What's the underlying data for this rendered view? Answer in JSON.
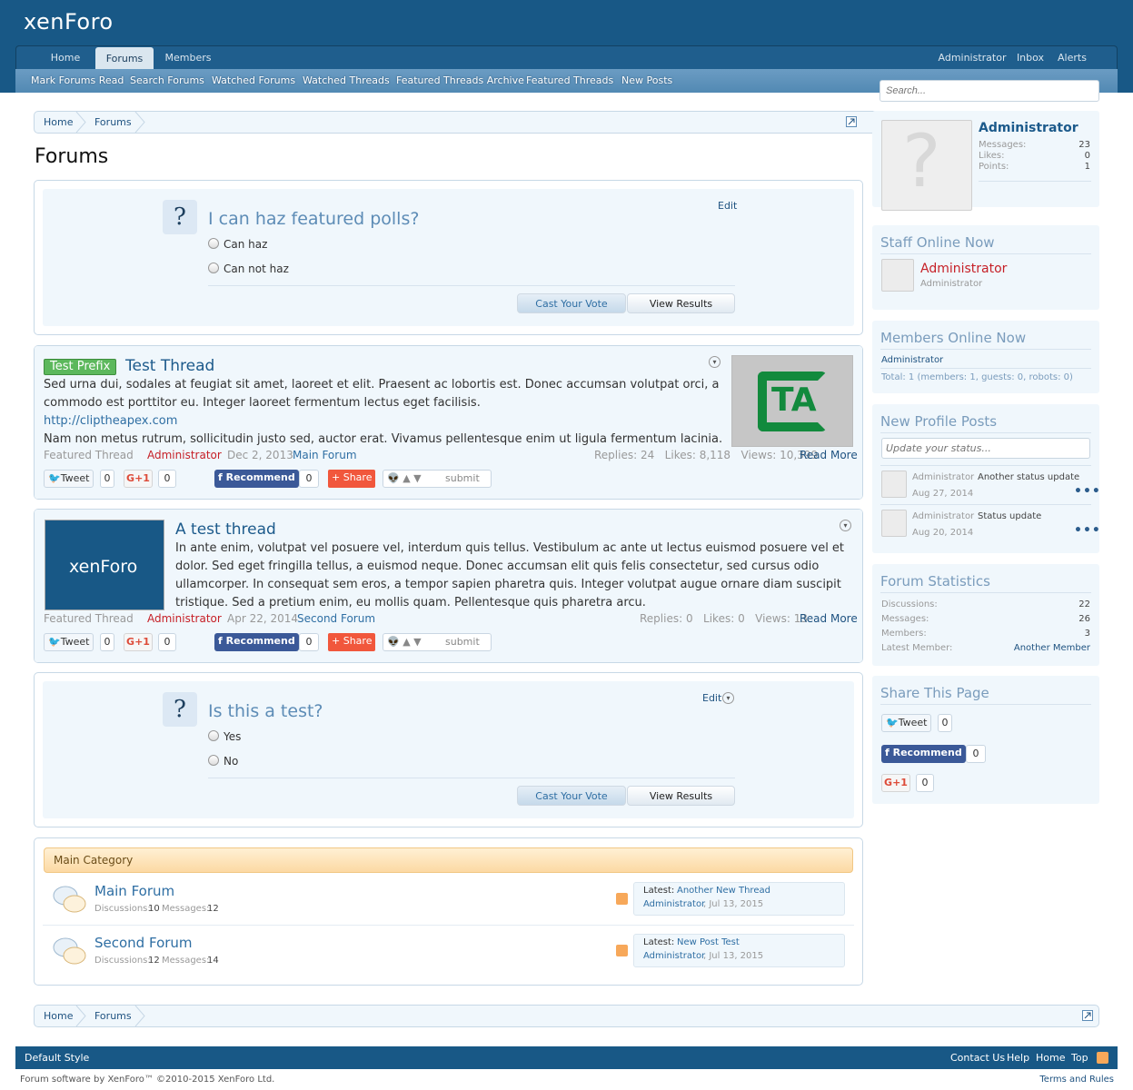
{
  "brand": {
    "logo": "xenForo",
    "accent": "#185886"
  },
  "nav": {
    "tabs": [
      {
        "label": "Home"
      },
      {
        "label": "Forums"
      },
      {
        "label": "Members"
      }
    ],
    "right": [
      {
        "label": "Administrator"
      },
      {
        "label": "Inbox"
      },
      {
        "label": "Alerts"
      }
    ],
    "subtabs": [
      {
        "label": "Mark Forums Read"
      },
      {
        "label": "Search Forums"
      },
      {
        "label": "Watched Forums"
      },
      {
        "label": "Watched Threads"
      },
      {
        "label": "Featured Threads Archive"
      },
      {
        "label": "Featured Threads"
      },
      {
        "label": "New Posts"
      }
    ]
  },
  "search": {
    "placeholder": "Search..."
  },
  "breadcrumb": [
    {
      "label": "Home"
    },
    {
      "label": "Forums"
    }
  ],
  "page_title": "Forums",
  "poll1": {
    "question": "I can haz featured polls?",
    "edit": "Edit",
    "options": [
      "Can haz",
      "Can not haz"
    ],
    "vote": "Cast Your Vote",
    "results": "View Results"
  },
  "thread1": {
    "prefix": "Test Prefix",
    "title": "Test Thread",
    "text1": "Sed urna dui, sodales at feugiat sit amet, laoreet et elit. Praesent ac lobortis est. Donec accumsan volutpat orci, a",
    "text2": "commodo est porttitor eu. Integer laoreet fermentum lectus eget facilisis.",
    "link": "http://cliptheapex.com",
    "text3": "Nam non metus rutrum, sollicitudin justo sed, auctor erat. Vivamus pellentesque enim ut ligula fermentum lacinia.",
    "featured": "Featured Thread",
    "author": "Administrator",
    "date": "Dec 2, 2013",
    "forum": "Main Forum",
    "stats": "Replies: 24   Likes: 8,118   Views: 10,399",
    "read_more": "Read More",
    "image_text": "TA"
  },
  "thread2": {
    "title": "A test thread",
    "text1": "In ante enim, volutpat vel posuere vel, interdum quis tellus. Vestibulum ac ante ut lectus euismod posuere vel et",
    "text2": "dolor. Sed eget fringilla tellus, a euismod neque. Donec accumsan elit quis felis consectetur, sed cursus odio",
    "text3": "ullamcorper. In consequat sem eros, a tempor sapien pharetra quis. Integer volutpat augue ornare diam suscipit",
    "text4": "tristique. Sed a pretium enim, eu mollis quam. Pellentesque quis pharetra arcu.",
    "featured": "Featured Thread",
    "author": "Administrator",
    "date": "Apr 22, 2014",
    "forum": "Second Forum",
    "stats": "Replies: 0   Likes: 0   Views: 13",
    "read_more": "Read More",
    "image_text": "xenForo"
  },
  "share": {
    "tweet": "Tweet",
    "count": "0",
    "gplus": "G+1",
    "recommend": "Recommend",
    "share": "Share",
    "submit": "submit"
  },
  "poll2": {
    "question": "Is this a test?",
    "edit": "Edit",
    "options": [
      "Yes",
      "No"
    ],
    "vote": "Cast Your Vote",
    "results": "View Results"
  },
  "category": {
    "title": "Main Category",
    "forums": [
      {
        "name": "Main Forum",
        "disc_label": "Discussions:",
        "disc": "10",
        "msg_label": "Messages:",
        "msg": "12",
        "latest_label": "Latest:",
        "latest": "Another New Thread",
        "by": "Administrator",
        "date": ", Jul 13, 2015"
      },
      {
        "name": "Second Forum",
        "disc_label": "Discussions:",
        "disc": "12",
        "msg_label": "Messages:",
        "msg": "14",
        "latest_label": "Latest:",
        "latest": "New Post Test",
        "by": "Administrator",
        "date": ", Jul 13, 2015"
      }
    ]
  },
  "sidebar": {
    "visitor": {
      "name": "Administrator",
      "rows": [
        {
          "label": "Messages:",
          "value": "23"
        },
        {
          "label": "Likes:",
          "value": "0"
        },
        {
          "label": "Points:",
          "value": "1"
        }
      ]
    },
    "staff": {
      "title": "Staff Online Now",
      "name": "Administrator",
      "role": "Administrator"
    },
    "members": {
      "title": "Members Online Now",
      "name": "Administrator",
      "total": "Total: 1 (members: 1, guests: 0, robots: 0)"
    },
    "profile": {
      "title": "New Profile Posts",
      "placeholder": "Update your status...",
      "posts": [
        {
          "author": "Administrator",
          "text": "Another status update",
          "date": "Aug 27, 2014"
        },
        {
          "author": "Administrator",
          "text": "Status update",
          "date": "Aug 20, 2014"
        }
      ]
    },
    "stats": {
      "title": "Forum Statistics",
      "rows": [
        {
          "label": "Discussions:",
          "value": "22"
        },
        {
          "label": "Messages:",
          "value": "26"
        },
        {
          "label": "Members:",
          "value": "3"
        },
        {
          "label": "Latest Member:",
          "value": "Another Member"
        }
      ]
    },
    "share": {
      "title": "Share This Page"
    }
  },
  "footer": {
    "style": "Default Style",
    "links": [
      {
        "label": "Contact Us"
      },
      {
        "label": "Help"
      },
      {
        "label": "Home"
      },
      {
        "label": "Top"
      }
    ],
    "copyright": "Forum software by XenForo™ ©2010-2015 XenForo Ltd.",
    "terms": "Terms and Rules"
  }
}
